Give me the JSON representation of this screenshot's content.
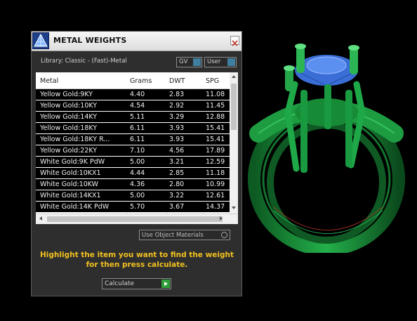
{
  "window": {
    "title": "METAL WEIGHTS"
  },
  "library_label": "Library: Classic - (Fast)-Metal",
  "toggles": {
    "gv": "GV",
    "user": "User"
  },
  "table": {
    "headers": [
      "Metal",
      "Grams",
      "DWT",
      "SPG"
    ],
    "rows": [
      [
        "Yellow Gold:9KY",
        "4.40",
        "2.83",
        "11.08"
      ],
      [
        "Yellow Gold:10KY",
        "4.54",
        "2.92",
        "11.45"
      ],
      [
        "Yellow Gold:14KY",
        "5.11",
        "3.29",
        "12.88"
      ],
      [
        "Yellow Gold:18KY",
        "6.11",
        "3.93",
        "15.41"
      ],
      [
        "Yellow Gold:18KY R...",
        "6.11",
        "3.93",
        "15.41"
      ],
      [
        "Yellow Gold:22KY",
        "7.10",
        "4.56",
        "17.89"
      ],
      [
        "White Gold:9K PdW",
        "5.00",
        "3.21",
        "12.59"
      ],
      [
        "White Gold:10KX1",
        "4.44",
        "2.85",
        "11.18"
      ],
      [
        "White Gold:10KW",
        "4.36",
        "2.80",
        "10.99"
      ],
      [
        "White Gold:14KX1",
        "5.00",
        "3.22",
        "12.61"
      ],
      [
        "White Gold:14K PdW",
        "5.70",
        "3.67",
        "14.37"
      ]
    ]
  },
  "use_object_materials": "Use Object Materials",
  "hint": "Highlight the item you want to find the weight for then press calculate.",
  "calculate": {
    "selected": "Calculate"
  },
  "colors": {
    "hint": "#f0c020",
    "ring_green": "#1a9a3c",
    "gem_blue": "#3a6ed6"
  },
  "icons": {
    "logo": "app-logo-icon",
    "close": "close-icon"
  }
}
